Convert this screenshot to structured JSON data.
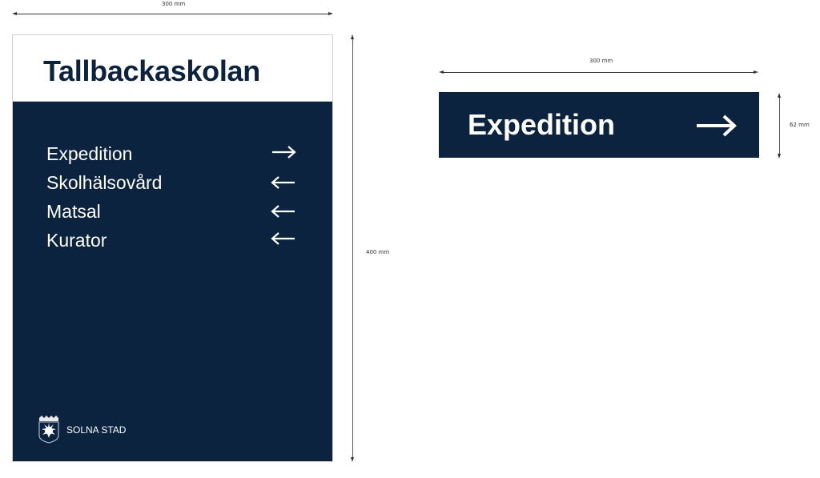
{
  "dimensions": {
    "big_width": "300 mm",
    "big_height": "400 mm",
    "small_width": "300 mm",
    "small_height": "62 mm"
  },
  "big_sign": {
    "title": "Tallbackaskolan",
    "destinations": [
      {
        "label": "Expedition",
        "direction": "right",
        "icon": "arrow-right-icon"
      },
      {
        "label": "Skolhälsovård",
        "direction": "left",
        "icon": "arrow-left-icon"
      },
      {
        "label": "Matsal",
        "direction": "left",
        "icon": "arrow-left-icon"
      },
      {
        "label": "Kurator",
        "direction": "left",
        "icon": "arrow-left-icon"
      }
    ],
    "footer": {
      "logo": "solna-coat-of-arms-icon",
      "text": "SOLNA STAD"
    }
  },
  "small_sign": {
    "label": "Expedition",
    "direction": "right",
    "icon": "arrow-right-icon"
  },
  "colors": {
    "navy": "#0c2340",
    "white": "#ffffff"
  }
}
